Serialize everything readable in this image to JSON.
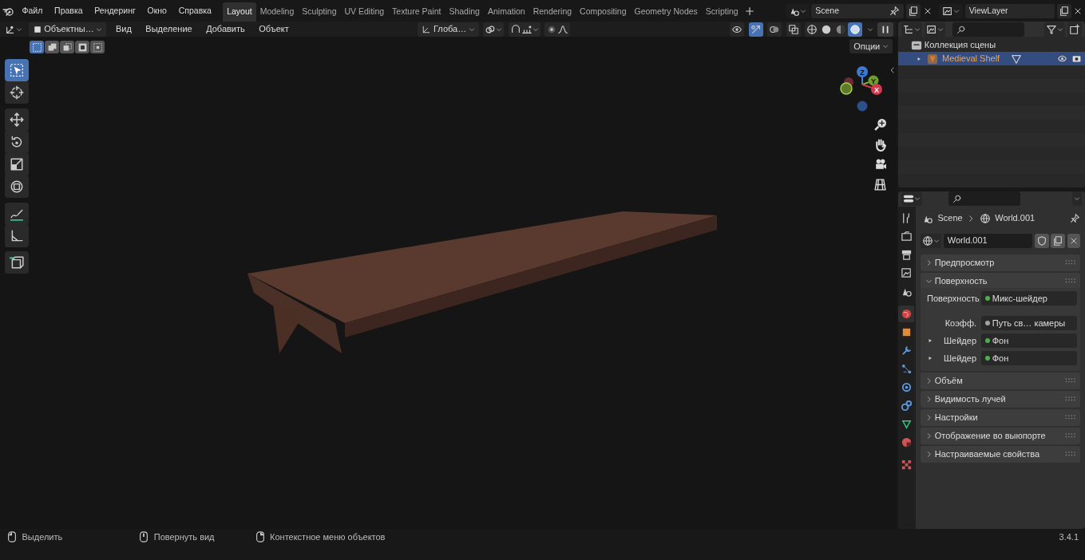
{
  "menu": [
    "Файл",
    "Правка",
    "Рендеринг",
    "Окно",
    "Справка"
  ],
  "workspaces": [
    {
      "label": "Layout",
      "selected": true
    },
    {
      "label": "Modeling",
      "selected": false
    },
    {
      "label": "Sculpting",
      "selected": false
    },
    {
      "label": "UV Editing",
      "selected": false
    },
    {
      "label": "Texture Paint",
      "selected": false
    },
    {
      "label": "Shading",
      "selected": false
    },
    {
      "label": "Animation",
      "selected": false
    },
    {
      "label": "Rendering",
      "selected": false
    },
    {
      "label": "Compositing",
      "selected": false
    },
    {
      "label": "Geometry Nodes",
      "selected": false
    },
    {
      "label": "Scripting",
      "selected": false
    }
  ],
  "scene": {
    "value": "Scene"
  },
  "view_layer": {
    "value": "ViewLayer"
  },
  "viewport_header": {
    "mode": "Объектны…",
    "menus": [
      "Вид",
      "Выделение",
      "Добавить",
      "Объект"
    ],
    "orientation": "Глоба…",
    "options": "Опции"
  },
  "header_toggles": [
    {
      "kind": "visibility",
      "on": false
    },
    {
      "kind": "gizmo",
      "on": true
    },
    {
      "kind": "overlay",
      "on": false
    },
    {
      "kind": "xray",
      "on": false
    }
  ],
  "shading": [
    {
      "kind": "wireframe",
      "selected": false
    },
    {
      "kind": "solid",
      "selected": false
    },
    {
      "kind": "material",
      "selected": false
    },
    {
      "kind": "rendered",
      "selected": true
    }
  ],
  "select_modes": [
    {
      "kind": "set",
      "selected": true
    },
    {
      "kind": "extend",
      "selected": false
    },
    {
      "kind": "subtract",
      "selected": false
    },
    {
      "kind": "invert",
      "selected": false
    },
    {
      "kind": "intersect",
      "selected": false
    }
  ],
  "tools": [
    {
      "kind": "select",
      "selected": true
    },
    {
      "kind": "cursor",
      "selected": false
    },
    {
      "kind": "move",
      "selected": false
    },
    {
      "kind": "rotate",
      "selected": false
    },
    {
      "kind": "scale",
      "selected": false
    },
    {
      "kind": "transform",
      "selected": false
    },
    {
      "kind": "annotate",
      "selected": false
    },
    {
      "kind": "measure",
      "selected": false
    },
    {
      "kind": "add",
      "selected": false
    }
  ],
  "gizmo": {
    "axes": [
      "Z",
      "Y",
      "X"
    ]
  },
  "outliner": {
    "collection": "Коллекция сцены",
    "items": [
      {
        "name": "Medieval Shelf",
        "selected": true
      }
    ]
  },
  "properties": {
    "breadcrumb": [
      "Scene",
      "World.001"
    ],
    "world": "World.001",
    "tabs": [
      {
        "kind": "tool",
        "selected": false
      },
      {
        "kind": "render",
        "selected": false
      },
      {
        "kind": "output",
        "selected": false
      },
      {
        "kind": "view_layer",
        "selected": false
      },
      {
        "kind": "scene",
        "selected": false
      },
      {
        "kind": "world",
        "selected": true
      },
      {
        "kind": "object",
        "selected": false
      },
      {
        "kind": "modifier",
        "selected": false
      },
      {
        "kind": "particles",
        "selected": false
      },
      {
        "kind": "physics",
        "selected": false
      },
      {
        "kind": "constraints",
        "selected": false
      },
      {
        "kind": "data",
        "selected": false
      },
      {
        "kind": "material",
        "selected": false
      },
      {
        "kind": "texture",
        "selected": false
      }
    ],
    "panels": [
      {
        "title": "Предпросмотр",
        "expanded": false
      },
      {
        "title": "Поверхность",
        "expanded": true,
        "fields": [
          {
            "label": "Поверхность",
            "value": "Микс-шейдер",
            "color": "#4cae4c",
            "expandable": false
          },
          {
            "label": "Коэфф.",
            "value": "Путь св… камеры",
            "color": "#a1a1a1",
            "expandable": false
          },
          {
            "label": "Шейдер",
            "value": "Фон",
            "color": "#4cae4c",
            "expandable": true
          },
          {
            "label": "Шейдер",
            "value": "Фон",
            "color": "#4cae4c",
            "expandable": true
          }
        ]
      },
      {
        "title": "Объём",
        "expanded": false
      },
      {
        "title": "Видимость лучей",
        "expanded": false
      },
      {
        "title": "Настройки",
        "expanded": false
      },
      {
        "title": "Отображение во выюпорте",
        "expanded": false
      },
      {
        "title": "Настраиваемые свойства",
        "expanded": false
      }
    ]
  },
  "status_bar": {
    "hints": [
      {
        "kind": "left",
        "label": "Выделить"
      },
      {
        "kind": "middle",
        "label": "Повернуть вид"
      },
      {
        "kind": "right",
        "label": "Контекстное меню объектов"
      }
    ],
    "version": "3.4.1"
  }
}
